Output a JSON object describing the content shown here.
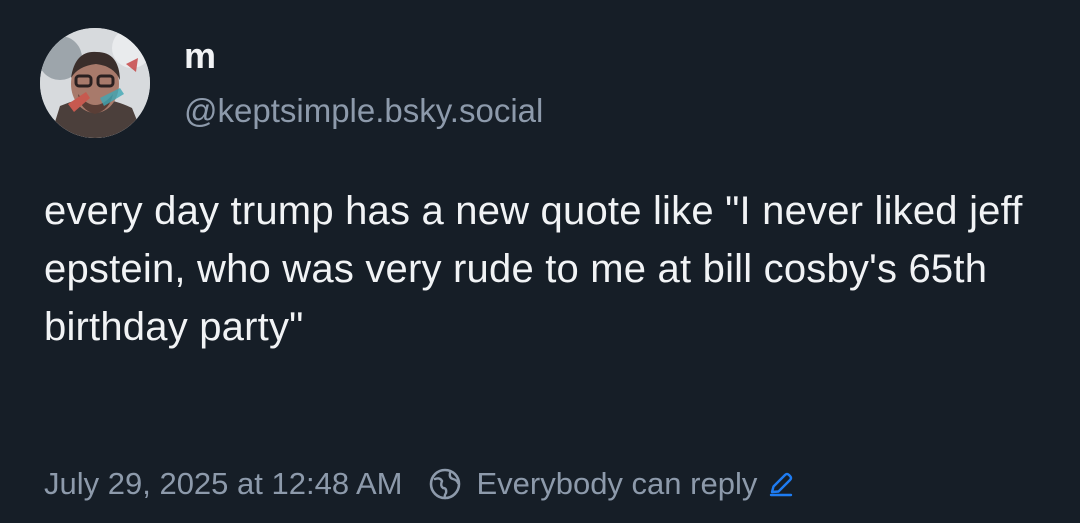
{
  "author": {
    "display_name": "m",
    "handle": "@keptsimple.bsky.social",
    "avatar_icon": "profile-photo"
  },
  "post": {
    "text": "every day trump has a new quote like \"I never liked jeff epstein, who was very rude to me at bill cosby's 65th birthday party\""
  },
  "meta": {
    "timestamp": "July 29, 2025 at 12:48 AM",
    "reply_setting_label": "Everybody can reply",
    "reply_setting_icon": "globe-icon",
    "edit_icon": "pencil-icon"
  },
  "colors": {
    "background": "#161e27",
    "text_primary": "#f1f3f5",
    "text_secondary": "#8d9aab",
    "accent": "#1e7cf2"
  }
}
